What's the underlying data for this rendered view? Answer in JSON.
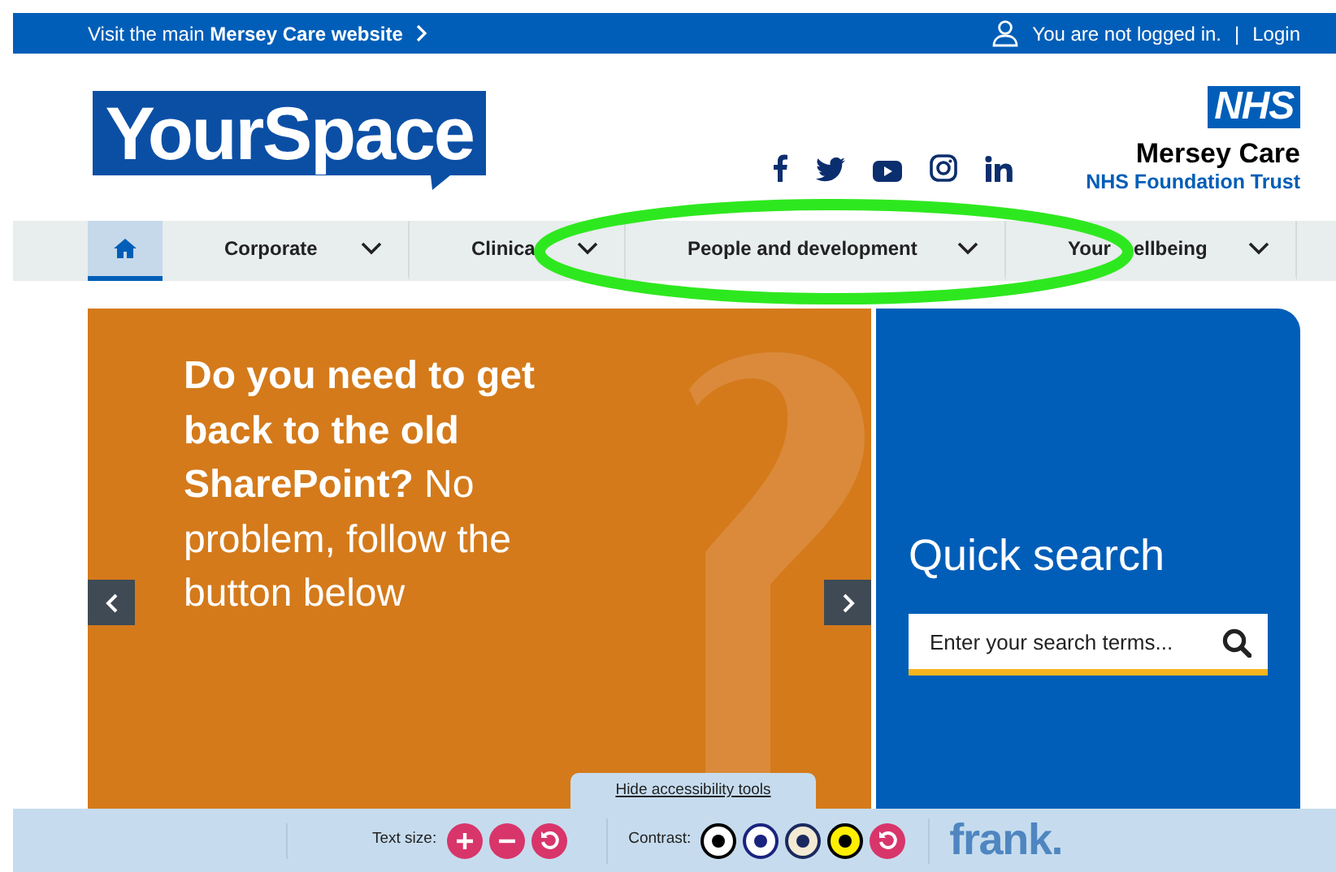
{
  "top_bar": {
    "link": "Visit the main **Mersey Care website**",
    "login_status": "You are not logged in.",
    "separator": "|",
    "login_link": "Login"
  },
  "header": {
    "logo": "YourSpace",
    "nhs_badge": "NHS",
    "org_name": "Mersey Care",
    "org_subtitle": "NHS Foundation Trust"
  },
  "nav": [
    {
      "kind": "home",
      "selected": true
    },
    {
      "kind": "menu",
      "label": "Corporate",
      "selected": false
    },
    {
      "kind": "menu",
      "label": "Clinica",
      "selected": false
    },
    {
      "kind": "menu",
      "label": "People and development",
      "selected": false
    },
    {
      "kind": "menu",
      "label": "Your",
      "label_after_cover": "ellbeing",
      "selected": false
    }
  ],
  "hero": {
    "text": "**Do you need to get back to the old SharePoint?** No problem, follow the button below"
  },
  "quick_search": {
    "title": "Quick search",
    "placeholder": "Enter your search terms..."
  },
  "accessibility": {
    "hide_link": "Hide accessibility tools",
    "text_size_label": "Text size:",
    "contrast_label": "Contrast:",
    "brand": "frank."
  }
}
